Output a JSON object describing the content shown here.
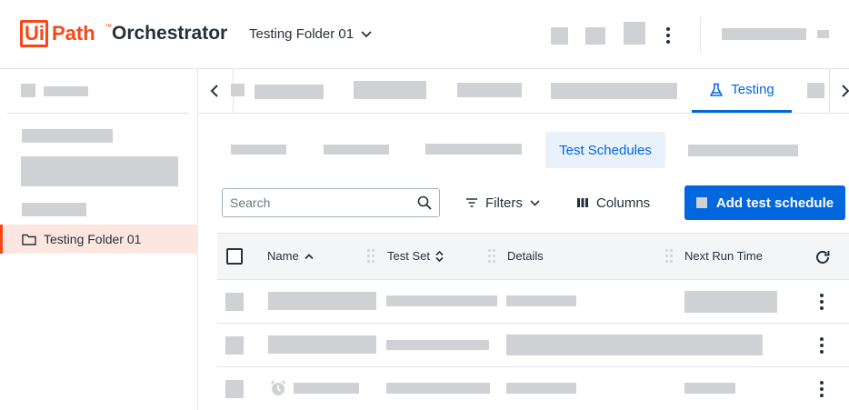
{
  "app": {
    "logo_ui": "Ui",
    "logo_path": "Path",
    "logo_tm": "™",
    "logo_product": "Orchestrator",
    "brand_color": "#fa4616",
    "accent_color": "#0067df"
  },
  "header": {
    "folder_selector": "Testing Folder 01",
    "folder_chevron_icon": "chevron-down-icon",
    "more_icon": "more-vert-icon"
  },
  "sidebar": {
    "selected_folder": "Testing Folder 01",
    "folder_icon": "folder-icon"
  },
  "tabs": {
    "active_label": "Testing",
    "active_icon": "flask-icon",
    "prev_icon": "chevron-left-icon",
    "next_icon": "chevron-right-icon"
  },
  "subtabs": {
    "active_label": "Test Schedules"
  },
  "toolbar": {
    "search_placeholder": "Search",
    "search_icon": "search-icon",
    "filters_label": "Filters",
    "filters_icon": "filter-icon",
    "columns_label": "Columns",
    "columns_icon": "columns-icon",
    "add_label": "Add test schedule"
  },
  "grid": {
    "columns": [
      "Name",
      "Test Set",
      "Details",
      "Next Run Time"
    ],
    "sort_name_icon": "sort-up-icon",
    "sort_testset_icon": "sort-updown-icon",
    "refresh_icon": "refresh-icon",
    "row_actions_icon": "more-vert-icon",
    "row3_status_icon": "alarm-icon"
  }
}
